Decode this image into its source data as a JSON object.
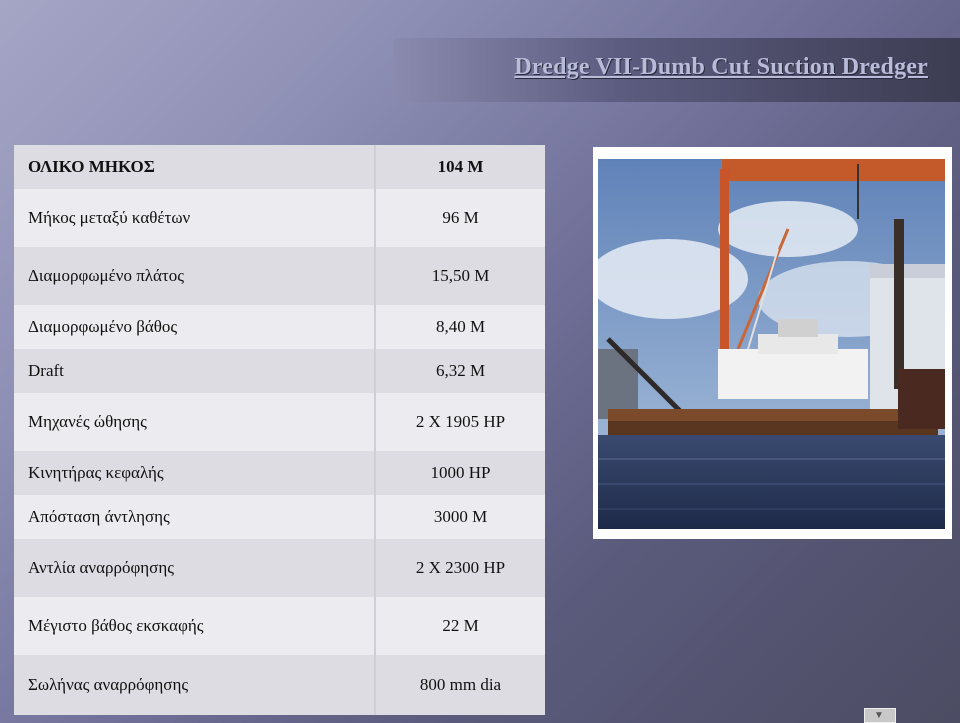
{
  "title": "Dredge VII-Dumb Cut Suction Dredger",
  "specs": [
    {
      "label": "ΟΛΙΚΟ ΜΗΚΟΣ",
      "value": "104 M"
    },
    {
      "label": "Μήκος μεταξύ καθέτων",
      "value": "96 M"
    },
    {
      "label": "Διαμορφωμένο πλάτος",
      "value": "15,50 M"
    },
    {
      "label": "Διαμορφωμένο βάθος",
      "value": "8,40 M"
    },
    {
      "label": "Draft",
      "value": "6,32 M"
    },
    {
      "label": "Μηχανές ώθησης",
      "value": "2 X 1905 HP"
    },
    {
      "label": "Κινητήρας κεφαλής",
      "value": "1000 HP"
    },
    {
      "label": "Απόσταση άντλησης",
      "value": "3000 M"
    },
    {
      "label": "Αντλία αναρρόφησης",
      "value": "2 X 2300 HP"
    },
    {
      "label": "Μέγιστο βάθος εκσκαφής",
      "value": "22 M"
    },
    {
      "label": "Σωλήνας αναρρόφησης",
      "value": "800 mm dia"
    }
  ],
  "nav_icon": "next-slide-icon"
}
